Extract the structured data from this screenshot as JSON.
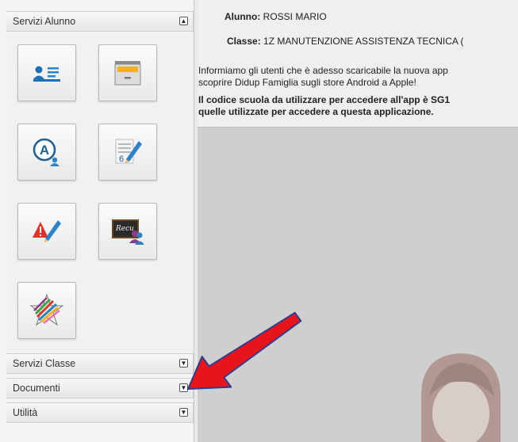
{
  "sidebar": {
    "sections": [
      {
        "title": "Servizi Alunno",
        "toggle": "▲",
        "expanded": true
      },
      {
        "title": "Servizi Classe",
        "toggle": "▼",
        "expanded": false
      },
      {
        "title": "Documenti",
        "toggle": "▼",
        "expanded": false
      },
      {
        "title": "Utilità",
        "toggle": "▼",
        "expanded": false
      }
    ],
    "tiles": [
      {
        "icon": "student-card-icon"
      },
      {
        "icon": "archive-drawer-icon"
      },
      {
        "icon": "absences-icon"
      },
      {
        "icon": "grades-notebook-icon"
      },
      {
        "icon": "notes-warning-icon"
      },
      {
        "icon": "recovery-blackboard-icon"
      },
      {
        "icon": "colorful-star-icon"
      }
    ]
  },
  "header": {
    "student_label": "Alunno:",
    "student_value": "ROSSI MARIO",
    "class_label": "Classe:",
    "class_value": "1Z MANUTENZIONE ASSISTENZA TECNICA ("
  },
  "notice": {
    "line1": "Informiamo gli utenti che è adesso scaricabile la nuova app",
    "line2": "scoprire Didup Famiglia sugli store Android a Apple!",
    "line3": "Il codice scuola da utilizzare per accedere all'app è SG1",
    "line4": "quelle utilizzate per accedere a questa applicazione."
  },
  "colors": {
    "arrow": "#e8141c",
    "arrow_outline": "#2a3f8f",
    "content_bg": "#cfcfcf",
    "avatar": "#b19893"
  }
}
